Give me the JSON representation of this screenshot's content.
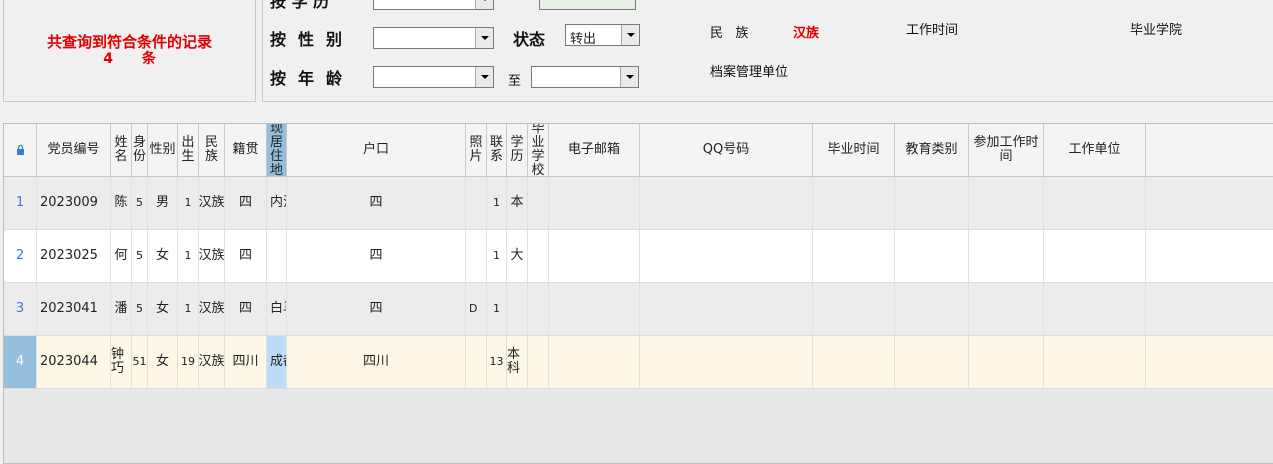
{
  "result": {
    "line1": "共查询到符合条件的记录",
    "count": "4",
    "unit": "条"
  },
  "filters": {
    "top_label": "按 学 历",
    "gender_label": [
      "按",
      "性",
      "别"
    ],
    "status_label": "状态",
    "status_value": "转出",
    "age_label": [
      "按",
      "年",
      "龄"
    ],
    "age_to": "至"
  },
  "info": {
    "nation_label": "民   族",
    "nation_value": "汉族",
    "work_time_label": "工作时间",
    "school_label": "毕业学院",
    "archive_label": "档案管理单位"
  },
  "grid": {
    "columns": [
      "党员编号",
      "姓名",
      "身份",
      "性别",
      "出生",
      "民族",
      "籍贯",
      "现居住地",
      "户口",
      "照片",
      "联系",
      "学历",
      "毕业学校",
      "电子邮箱",
      "QQ号码",
      "毕业时间",
      "教育类别",
      "参加工作时间",
      "工作单位"
    ],
    "rows": [
      {
        "no": "1",
        "id": "2023009",
        "name": "陈",
        "identity": "5",
        "gender": "男",
        "birth": "1",
        "nation": "汉族",
        "native": "四",
        "address": "内江",
        "hukou": "四",
        "photo": "",
        "contact": "1",
        "edu": "本"
      },
      {
        "no": "2",
        "id": "2023025",
        "name": "何",
        "identity": "5",
        "gender": "女",
        "birth": "1",
        "nation": "汉族",
        "native": "四",
        "address": "",
        "hukou": "四",
        "photo": "",
        "contact": "1",
        "edu": "大"
      },
      {
        "no": "3",
        "id": "2023041",
        "name": "潘",
        "identity": "5",
        "gender": "女",
        "birth": "1",
        "nation": "汉族",
        "native": "四",
        "address": "白马",
        "hukou": "四",
        "photo": "D",
        "contact": "1",
        "edu": ""
      },
      {
        "no": "4",
        "id": "2023044",
        "name": "钟巧",
        "identity": "51",
        "gender": "女",
        "birth": "19",
        "nation": "汉族",
        "native": "四川",
        "address": "成都",
        "hukou": "四川",
        "photo": "",
        "contact": "13",
        "edu": "本科"
      }
    ]
  },
  "colors": {
    "accent_red": "#e00000",
    "header_selected": "#96bfde",
    "row_current": "#fdf7e6"
  },
  "icons": {
    "header_corner": "lock-icon"
  }
}
